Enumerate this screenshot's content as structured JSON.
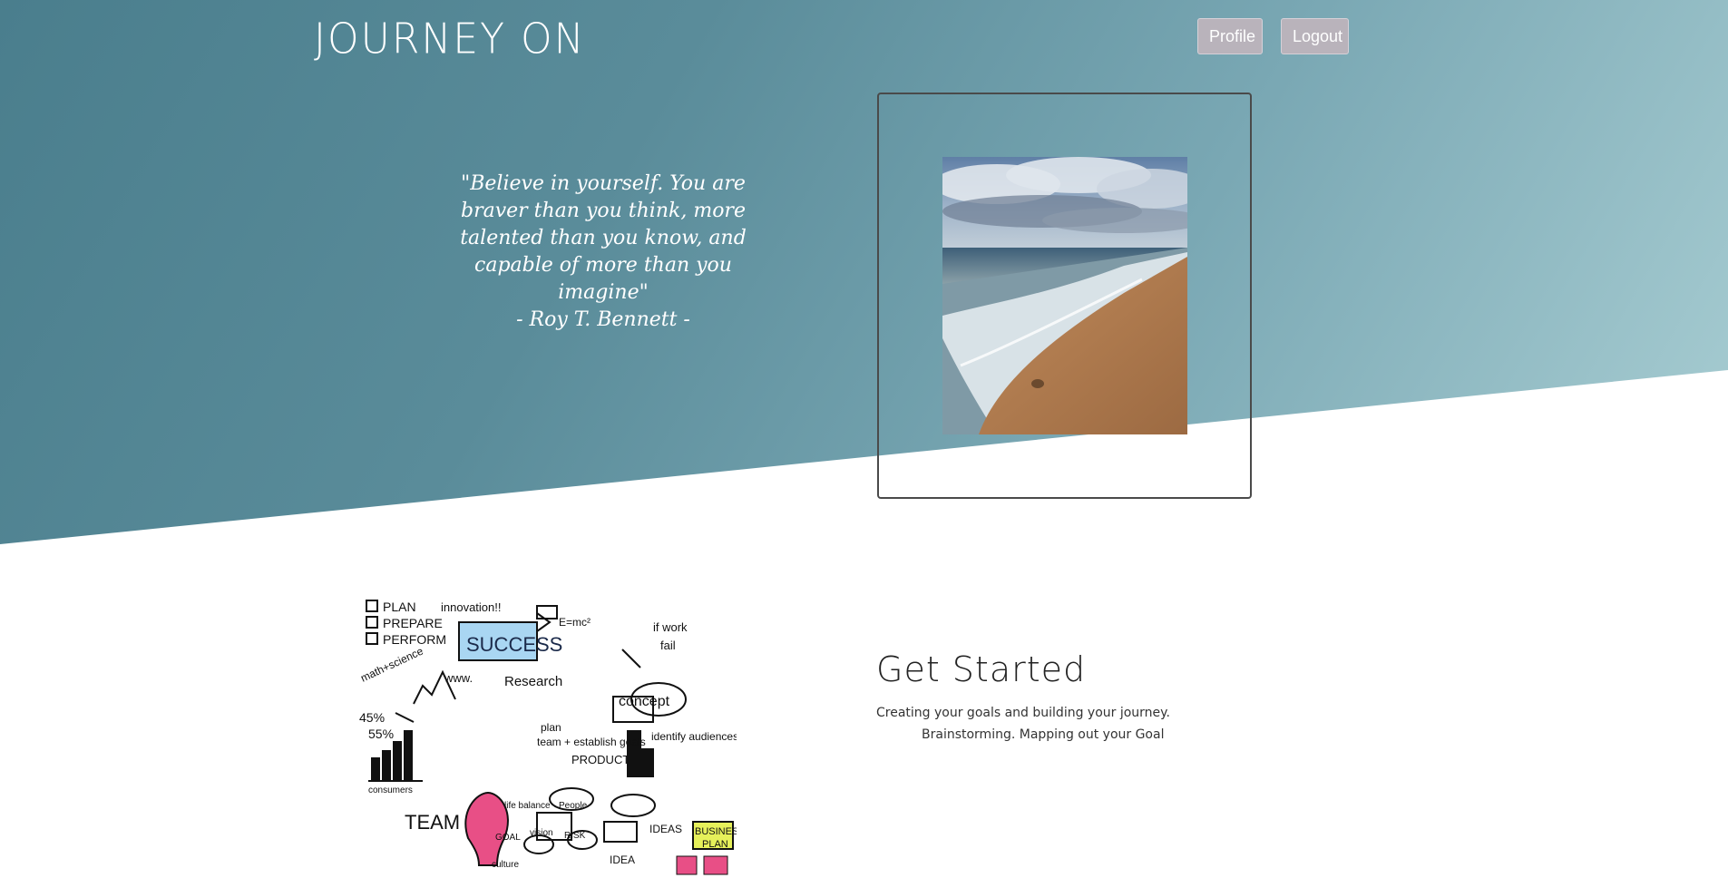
{
  "header": {
    "brand": "JOURNEY ON",
    "profile_label": "Profile",
    "logout_label": "Logout"
  },
  "hero": {
    "quote": "\"Believe in yourself. You are braver than you think, more talented than you know, and capable of more than you imagine\"",
    "author": "- Roy T. Bennett -",
    "image": "beach-photo"
  },
  "get_started": {
    "title": "Get Started",
    "line1": "Creating your goals and building your journey.",
    "line2": "Brainstorming. Mapping out your Goal",
    "image": "success-sketch-illustration"
  },
  "colors": {
    "hero_start": "#4a7e8d",
    "hero_end": "#a9ced3",
    "button_bg": "#b9b3bb"
  }
}
